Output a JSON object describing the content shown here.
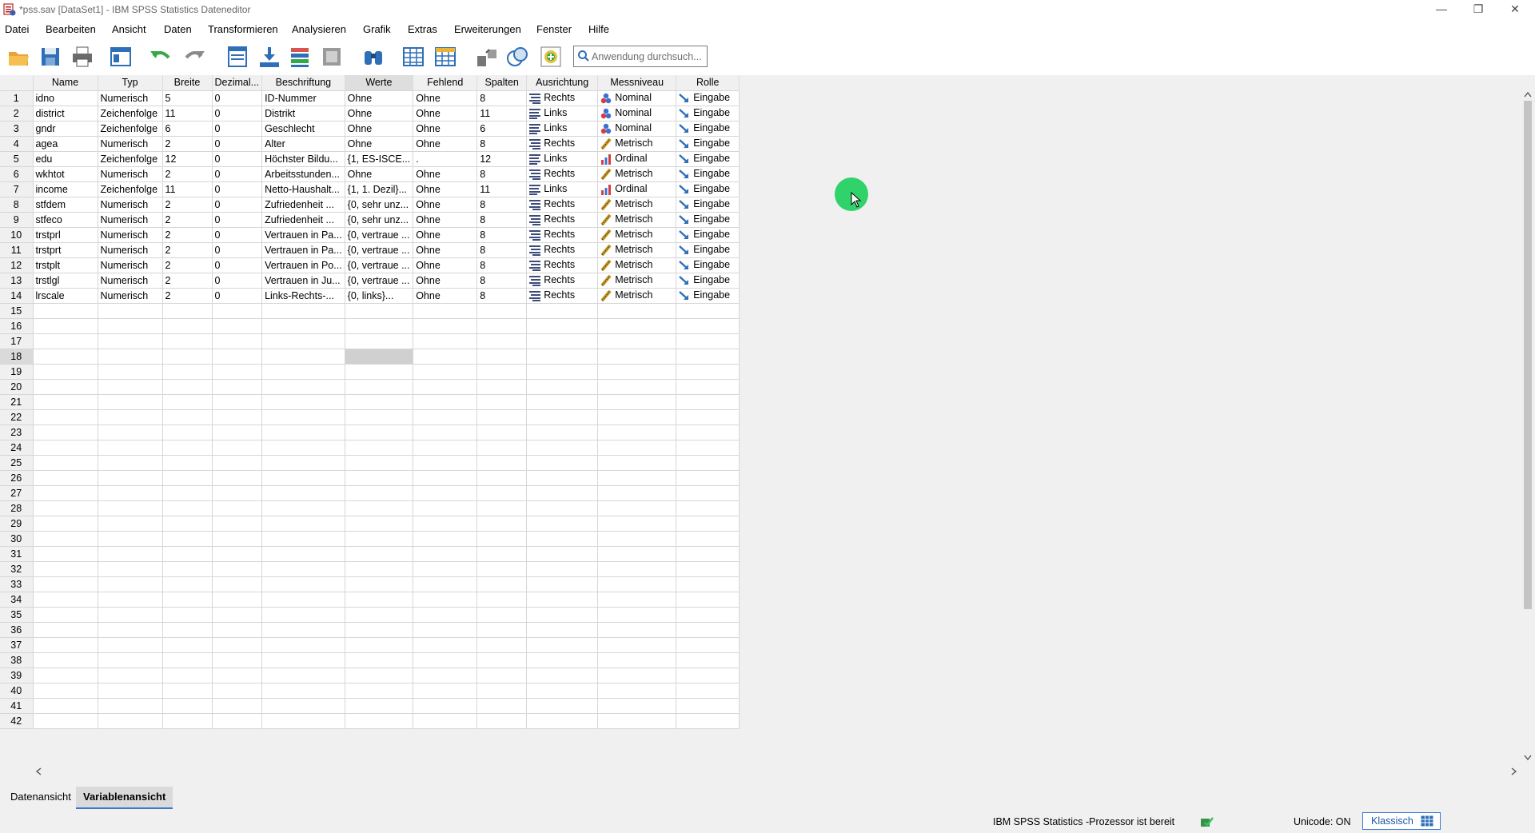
{
  "window": {
    "title": "*pss.sav [DataSet1] - IBM SPSS Statistics Dateneditor",
    "controls": [
      "—",
      "❐",
      "✕"
    ]
  },
  "menu": [
    "Datei",
    "Bearbeiten",
    "Ansicht",
    "Daten",
    "Transformieren",
    "Analysieren",
    "Grafik",
    "Extras",
    "Erweiterungen",
    "Fenster",
    "Hilfe"
  ],
  "toolbar": {
    "search_placeholder": "Anwendung durchsuch..."
  },
  "columns": [
    "Name",
    "Typ",
    "Breite",
    "Dezimal...",
    "Beschriftung",
    "Werte",
    "Fehlend",
    "Spalten",
    "Ausrichtung",
    "Messniveau",
    "Rolle"
  ],
  "variables": [
    {
      "n": "1",
      "name": "idno",
      "typ": "Numerisch",
      "breite": "5",
      "dez": "0",
      "label": "ID-Nummer",
      "werte": "Ohne",
      "fehlend": "Ohne",
      "spalten": "8",
      "ausr": "Rechts",
      "mess": "Nominal",
      "rolle": "Eingabe"
    },
    {
      "n": "2",
      "name": "district",
      "typ": "Zeichenfolge",
      "breite": "11",
      "dez": "0",
      "label": "Distrikt",
      "werte": "Ohne",
      "fehlend": "Ohne",
      "spalten": "11",
      "ausr": "Links",
      "mess": "Nominal",
      "rolle": "Eingabe"
    },
    {
      "n": "3",
      "name": "gndr",
      "typ": "Zeichenfolge",
      "breite": "6",
      "dez": "0",
      "label": "Geschlecht",
      "werte": "Ohne",
      "fehlend": "Ohne",
      "spalten": "6",
      "ausr": "Links",
      "mess": "Nominal",
      "rolle": "Eingabe"
    },
    {
      "n": "4",
      "name": "agea",
      "typ": "Numerisch",
      "breite": "2",
      "dez": "0",
      "label": "Alter",
      "werte": "Ohne",
      "fehlend": "Ohne",
      "spalten": "8",
      "ausr": "Rechts",
      "mess": "Metrisch",
      "rolle": "Eingabe"
    },
    {
      "n": "5",
      "name": "edu",
      "typ": "Zeichenfolge",
      "breite": "12",
      "dez": "0",
      "label": "Höchster Bildu...",
      "werte": "{1, ES-ISCE...",
      "fehlend": ".",
      "spalten": "12",
      "ausr": "Links",
      "mess": "Ordinal",
      "rolle": "Eingabe"
    },
    {
      "n": "6",
      "name": "wkhtot",
      "typ": "Numerisch",
      "breite": "2",
      "dez": "0",
      "label": "Arbeitsstunden...",
      "werte": "Ohne",
      "fehlend": "Ohne",
      "spalten": "8",
      "ausr": "Rechts",
      "mess": "Metrisch",
      "rolle": "Eingabe"
    },
    {
      "n": "7",
      "name": "income",
      "typ": "Zeichenfolge",
      "breite": "11",
      "dez": "0",
      "label": "Netto-Haushalt...",
      "werte": "{1, 1. Dezil}...",
      "fehlend": "Ohne",
      "spalten": "11",
      "ausr": "Links",
      "mess": "Ordinal",
      "rolle": "Eingabe"
    },
    {
      "n": "8",
      "name": "stfdem",
      "typ": "Numerisch",
      "breite": "2",
      "dez": "0",
      "label": "Zufriedenheit ...",
      "werte": "{0, sehr unz...",
      "fehlend": "Ohne",
      "spalten": "8",
      "ausr": "Rechts",
      "mess": "Metrisch",
      "rolle": "Eingabe"
    },
    {
      "n": "9",
      "name": "stfeco",
      "typ": "Numerisch",
      "breite": "2",
      "dez": "0",
      "label": "Zufriedenheit ...",
      "werte": "{0, sehr unz...",
      "fehlend": "Ohne",
      "spalten": "8",
      "ausr": "Rechts",
      "mess": "Metrisch",
      "rolle": "Eingabe"
    },
    {
      "n": "10",
      "name": "trstprl",
      "typ": "Numerisch",
      "breite": "2",
      "dez": "0",
      "label": "Vertrauen in Pa...",
      "werte": "{0, vertraue ...",
      "fehlend": "Ohne",
      "spalten": "8",
      "ausr": "Rechts",
      "mess": "Metrisch",
      "rolle": "Eingabe"
    },
    {
      "n": "11",
      "name": "trstprt",
      "typ": "Numerisch",
      "breite": "2",
      "dez": "0",
      "label": "Vertrauen in Pa...",
      "werte": "{0, vertraue ...",
      "fehlend": "Ohne",
      "spalten": "8",
      "ausr": "Rechts",
      "mess": "Metrisch",
      "rolle": "Eingabe"
    },
    {
      "n": "12",
      "name": "trstplt",
      "typ": "Numerisch",
      "breite": "2",
      "dez": "0",
      "label": "Vertrauen in Po...",
      "werte": "{0, vertraue ...",
      "fehlend": "Ohne",
      "spalten": "8",
      "ausr": "Rechts",
      "mess": "Metrisch",
      "rolle": "Eingabe"
    },
    {
      "n": "13",
      "name": "trstlgl",
      "typ": "Numerisch",
      "breite": "2",
      "dez": "0",
      "label": "Vertrauen in Ju...",
      "werte": "{0, vertraue ...",
      "fehlend": "Ohne",
      "spalten": "8",
      "ausr": "Rechts",
      "mess": "Metrisch",
      "rolle": "Eingabe"
    },
    {
      "n": "14",
      "name": "lrscale",
      "typ": "Numerisch",
      "breite": "2",
      "dez": "0",
      "label": "Links-Rechts-...",
      "werte": "{0, links}...",
      "fehlend": "Ohne",
      "spalten": "8",
      "ausr": "Rechts",
      "mess": "Metrisch",
      "rolle": "Eingabe"
    }
  ],
  "empty_rows": [
    "15",
    "16",
    "17",
    "18",
    "19",
    "20",
    "21",
    "22",
    "23",
    "24",
    "25",
    "26",
    "27",
    "28",
    "29",
    "30",
    "31",
    "32",
    "33",
    "34",
    "35",
    "36",
    "37",
    "38",
    "39",
    "40",
    "41",
    "42"
  ],
  "selected_row": "18",
  "tabs": [
    "Datenansicht",
    "Variablenansicht"
  ],
  "active_tab": "Variablenansicht",
  "status": {
    "processor": "IBM SPSS Statistics -Prozessor ist bereit",
    "unicode": "Unicode: ON",
    "mode_button": "Klassisch"
  },
  "colors": {
    "accent": "#3a78d0",
    "cursor_highlight": "#2fd36a",
    "grid_line": "#d6d6d6"
  }
}
